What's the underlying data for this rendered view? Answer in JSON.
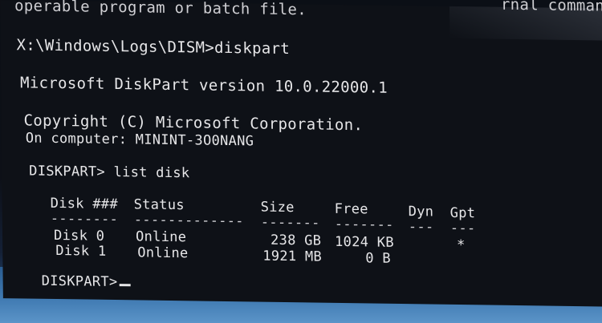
{
  "console": {
    "line_error": "operable program or batch file.",
    "line_error_right": "rnal command,",
    "prompt_cmd": "X:\\Windows\\Logs\\DISM>diskpart",
    "version": "Microsoft DiskPart version 10.0.22000.1",
    "copyright": "Copyright (C) Microsoft Corporation.",
    "computer": "On computer: MININT-3O0NANG",
    "list_cmd": "DISKPART> list disk",
    "table": {
      "headers": {
        "disk": "Disk ###",
        "status": "Status",
        "size": "Size",
        "free": "Free",
        "dyn": "Dyn",
        "gpt": "Gpt"
      },
      "separators": {
        "disk": "--------",
        "status": "-------------",
        "size": "-------",
        "free": "-------",
        "dyn": "---",
        "gpt": "---"
      },
      "rows": [
        {
          "disk": "Disk 0",
          "status": "Online",
          "size": "238 GB",
          "free": "1024 KB",
          "dyn": "",
          "gpt": "*"
        },
        {
          "disk": "Disk 1",
          "status": "Online",
          "size": "1921 MB",
          "free": "0 B",
          "dyn": "",
          "gpt": ""
        }
      ]
    },
    "final_prompt": "DISKPART>"
  }
}
